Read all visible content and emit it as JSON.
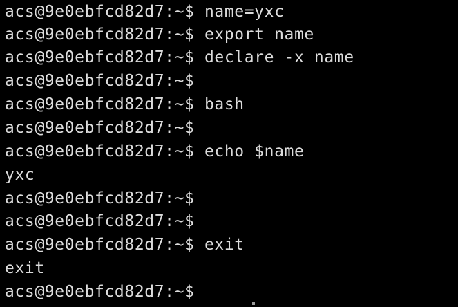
{
  "terminal": {
    "lines": [
      {
        "prompt": "acs@9e0ebfcd82d7:~$",
        "command": " name=yxc"
      },
      {
        "prompt": "acs@9e0ebfcd82d7:~$",
        "command": " export name"
      },
      {
        "prompt": "acs@9e0ebfcd82d7:~$",
        "command": " declare -x name"
      },
      {
        "prompt": "acs@9e0ebfcd82d7:~$",
        "command": ""
      },
      {
        "prompt": "acs@9e0ebfcd82d7:~$",
        "command": " bash"
      },
      {
        "prompt": "acs@9e0ebfcd82d7:~$",
        "command": ""
      },
      {
        "prompt": "acs@9e0ebfcd82d7:~$",
        "command": " echo $name"
      },
      {
        "output": "yxc"
      },
      {
        "prompt": "acs@9e0ebfcd82d7:~$",
        "command": ""
      },
      {
        "prompt": "acs@9e0ebfcd82d7:~$",
        "command": ""
      },
      {
        "prompt": "acs@9e0ebfcd82d7:~$",
        "command": " exit"
      },
      {
        "output": "exit"
      },
      {
        "prompt": "acs@9e0ebfcd82d7:~$",
        "command": ""
      }
    ]
  }
}
